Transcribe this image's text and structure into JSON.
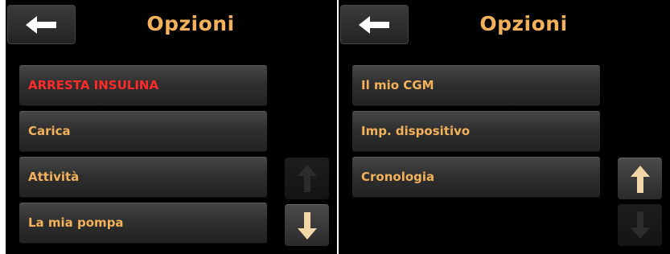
{
  "colors": {
    "title": "#f2b15a",
    "item_text": "#f2b15a",
    "stop_insulin_text": "#ff2a2a",
    "arrow_enabled": "#f1d6a6",
    "arrow_disabled": "#2c2c2c",
    "back_arrow": "#ffffff"
  },
  "left_screen": {
    "back_button": {
      "icon": "arrow-left-icon"
    },
    "title": "Opzioni",
    "menu_items": [
      {
        "label": "ARRESTA INSULINA",
        "style": "alert"
      },
      {
        "label": "Carica",
        "style": "normal"
      },
      {
        "label": "Attività",
        "style": "normal"
      },
      {
        "label": "La mia pompa",
        "style": "normal"
      }
    ],
    "scroll_up": {
      "icon": "arrow-up-icon",
      "enabled": false
    },
    "scroll_down": {
      "icon": "arrow-down-icon",
      "enabled": true
    }
  },
  "right_screen": {
    "back_button": {
      "icon": "arrow-left-icon"
    },
    "title": "Opzioni",
    "menu_items": [
      {
        "label": "Il mio CGM",
        "style": "normal"
      },
      {
        "label": "Imp. dispositivo",
        "style": "normal"
      },
      {
        "label": "Cronologia",
        "style": "normal"
      }
    ],
    "scroll_up": {
      "icon": "arrow-up-icon",
      "enabled": true
    },
    "scroll_down": {
      "icon": "arrow-down-icon",
      "enabled": false
    }
  }
}
